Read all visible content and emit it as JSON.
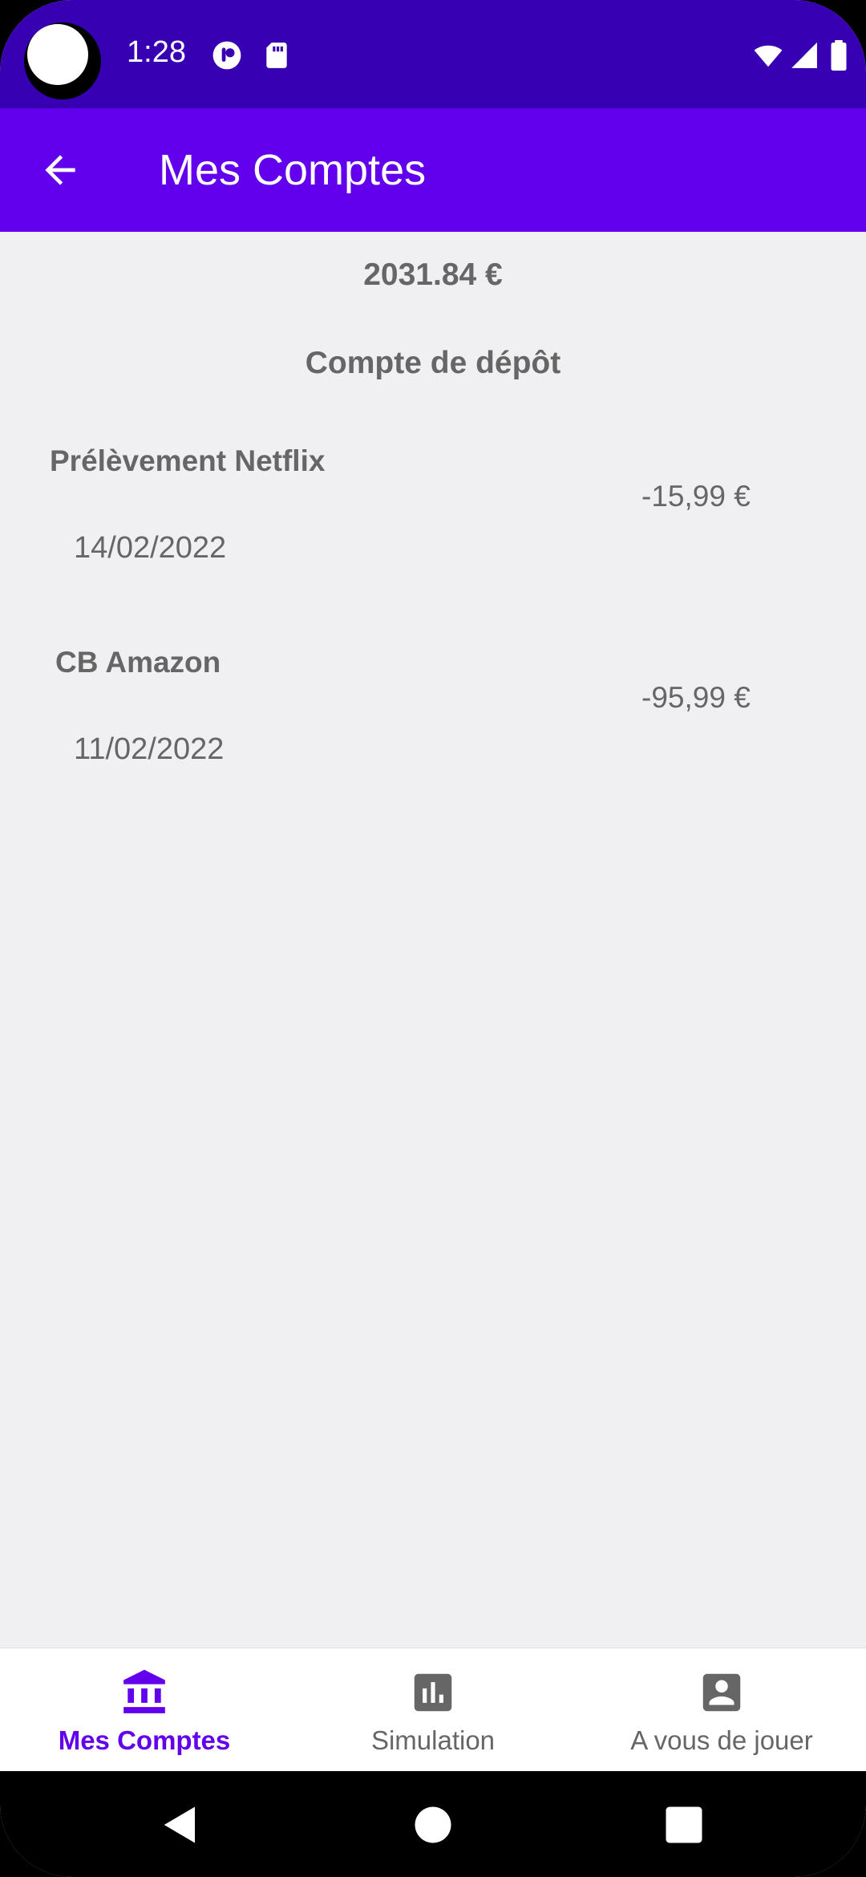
{
  "status_bar": {
    "time": "1:28",
    "icons": [
      "camera-notification-icon",
      "sd-card-icon",
      "wifi-icon",
      "signal-icon",
      "battery-icon"
    ]
  },
  "app_bar": {
    "title": "Mes Comptes",
    "back_icon": "arrow-back-icon"
  },
  "main": {
    "balance": "2031.84 €",
    "account_name": "Compte de dépôt",
    "transactions": [
      {
        "label": "Prélèvement Netflix",
        "amount": "-15,99 €",
        "date": "14/02/2022"
      },
      {
        "label": "CB Amazon",
        "amount": "-95,99 €",
        "date": "11/02/2022"
      }
    ]
  },
  "bottom_nav": {
    "items": [
      {
        "label": "Mes Comptes",
        "icon": "bank-icon",
        "active": true
      },
      {
        "label": "Simulation",
        "icon": "bar-chart-icon",
        "active": false
      },
      {
        "label": "A vous de jouer",
        "icon": "account-box-icon",
        "active": false
      }
    ]
  },
  "colors": {
    "status_bar": "#3700b3",
    "primary": "#6200ee",
    "background": "#f0f0f3",
    "text": "#666666"
  }
}
